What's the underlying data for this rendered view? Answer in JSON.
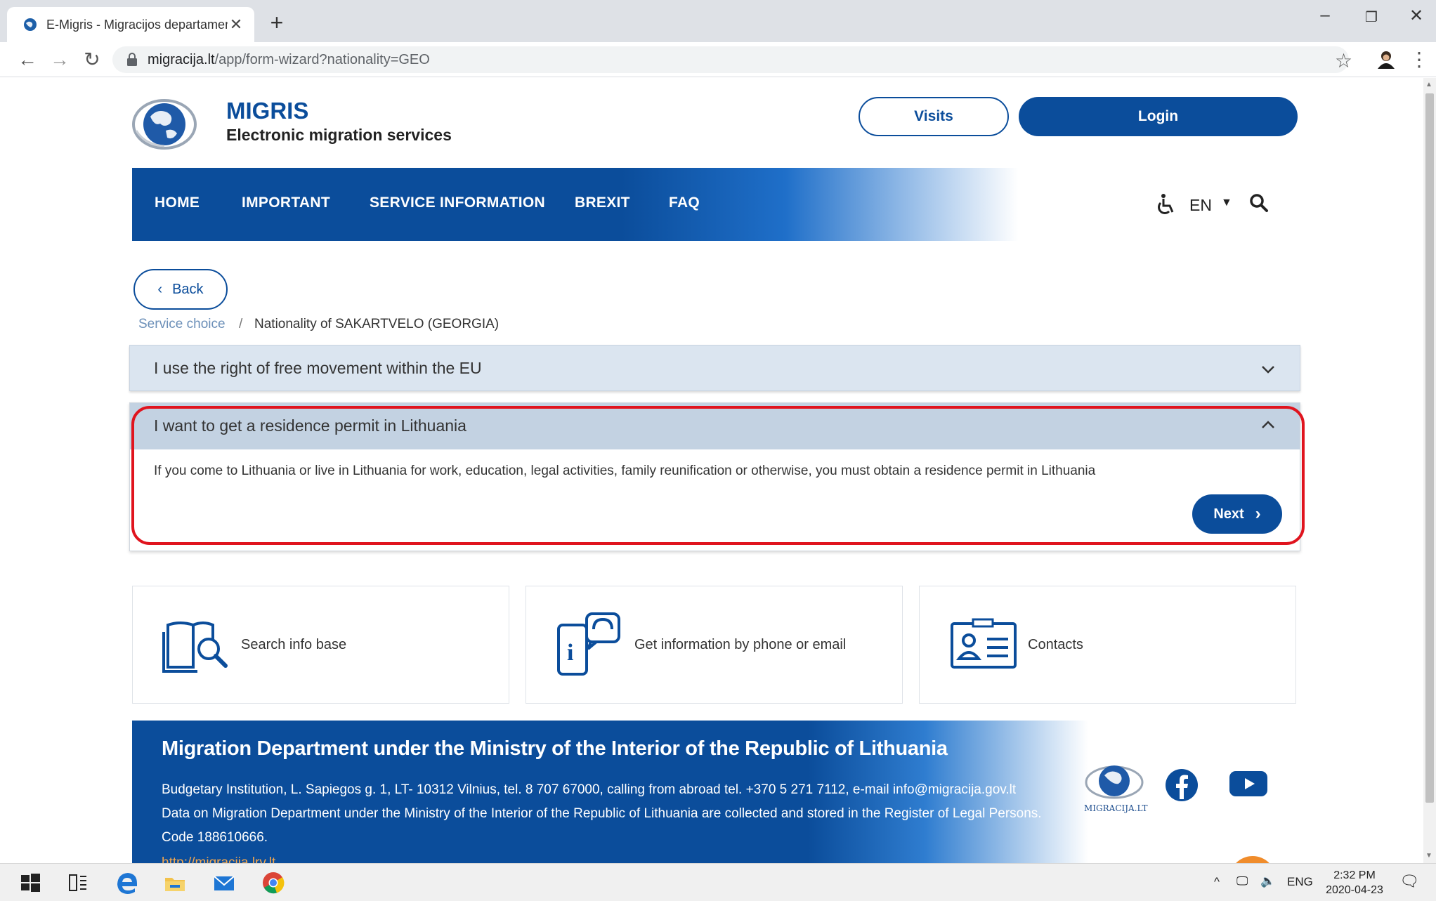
{
  "browser": {
    "tab_title": "E-Migris - Migracijos departamen",
    "url_host": "migracija.lt",
    "url_path": "/app/form-wizard?nationality=GEO",
    "icons": [
      "favicon-globe-icon",
      "close-icon",
      "plus-icon",
      "back-arrow-icon",
      "forward-arrow-icon",
      "reload-icon",
      "lock-icon",
      "star-icon",
      "profile-icon",
      "more-menu-icon",
      "minimize-icon",
      "restore-icon",
      "window-close-icon"
    ]
  },
  "header": {
    "brand": "MIGRIS",
    "brand_sub": "Electronic migration services",
    "visits_label": "Visits",
    "login_label": "Login"
  },
  "nav": {
    "items": [
      "HOME",
      "IMPORTANT",
      "SERVICE INFORMATION",
      "BREXIT",
      "FAQ"
    ],
    "lang": "EN"
  },
  "back_label": "Back",
  "breadcrumb": {
    "link": "Service choice",
    "separator": "/",
    "current": "Nationality of SAKARTVELO (GEORGIA)"
  },
  "accordion": [
    {
      "title": "I use the right of free movement within the EU",
      "expanded": false
    },
    {
      "title": "I want to get a residence permit in Lithuania",
      "expanded": true,
      "body": "If you come to Lithuania or live in Lithuania for work, education, legal activities, family reunification or otherwise, you must obtain a residence permit in Lithuania",
      "next_label": "Next"
    }
  ],
  "cards": [
    {
      "label": "Search info base",
      "icon": "book-search-icon"
    },
    {
      "label": "Get information by phone or email",
      "icon": "phone-info-icon"
    },
    {
      "label": "Contacts",
      "icon": "contact-card-icon"
    }
  ],
  "footer": {
    "title": "Migration Department under the Ministry of the Interior of the Republic of Lithuania",
    "line1": "Budgetary Institution, L. Sapiegos g. 1, LT- 10312 Vilnius, tel. 8 707 67000, calling from abroad tel. +370 5 271 7112, e-mail info@migracija.gov.lt",
    "line2": "Data on Migration Department under the Ministry of the Interior of the Republic of Lithuania are collected and stored in the Register of Legal Persons.",
    "line3": "Code 188610666.",
    "link": "http://migracija.lrv.lt",
    "logo_text": "MIGRACIJA.LT"
  },
  "taskbar": {
    "lang": "ENG",
    "time": "2:32 PM",
    "date": "2020-04-23"
  },
  "colors": {
    "brand_blue": "#0b4d9b",
    "highlight_red": "#e0141e",
    "accordion_bg": "#dbe5f0"
  }
}
